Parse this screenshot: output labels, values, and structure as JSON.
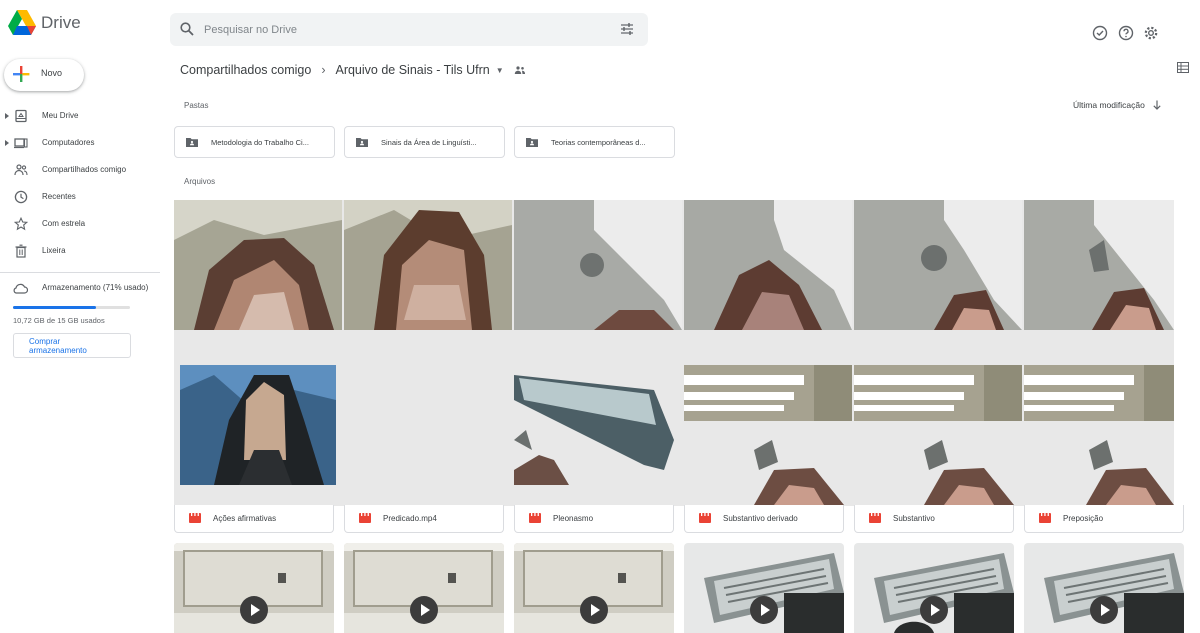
{
  "app": {
    "name": "Drive",
    "brand_colors": [
      "#0066da",
      "#00ac47",
      "#ea4335",
      "#ffba00"
    ]
  },
  "search": {
    "placeholder": "Pesquisar no Drive",
    "icon": "search-icon",
    "options_icon": "tune-icon"
  },
  "header_icons": [
    "offline-status-icon",
    "help-icon",
    "settings-icon"
  ],
  "sidebar": {
    "new_label": "Novo",
    "items": [
      {
        "label": "Meu Drive",
        "icon": "my-drive-icon",
        "expandable": true
      },
      {
        "label": "Computadores",
        "icon": "computer-icon",
        "expandable": true
      },
      {
        "label": "Compartilhados comigo",
        "icon": "shared-icon",
        "expandable": false
      },
      {
        "label": "Recentes",
        "icon": "clock-icon",
        "expandable": false
      },
      {
        "label": "Com estrela",
        "icon": "star-icon",
        "expandable": false
      },
      {
        "label": "Lixeira",
        "icon": "trash-icon",
        "expandable": false
      }
    ],
    "storage": {
      "label": "Armazenamento (71% usado)",
      "used_text": "10,72 GB de 15 GB usados",
      "fraction": 0.71,
      "buy_label": "Comprar armazenamento"
    }
  },
  "breadcrumb": {
    "root": "Compartilhados comigo",
    "current": "Arquivo de Sinais - Tils Ufrn"
  },
  "sections": {
    "folders": "Pastas",
    "files": "Arquivos"
  },
  "sort": {
    "label": "Última modificação"
  },
  "folders": [
    {
      "name": "Metodologia do Trabalho Ci..."
    },
    {
      "name": "Sinais da Área de Linguísti..."
    },
    {
      "name": "Teorias contemporâneas d..."
    }
  ],
  "files": [
    {
      "name": "Ações afirmativas"
    },
    {
      "name": "Predicado.mp4"
    },
    {
      "name": "Pleonasmo"
    },
    {
      "name": "Substantivo derivado"
    },
    {
      "name": "Substantivo"
    },
    {
      "name": "Preposição"
    }
  ],
  "video_color": "#ea4335"
}
